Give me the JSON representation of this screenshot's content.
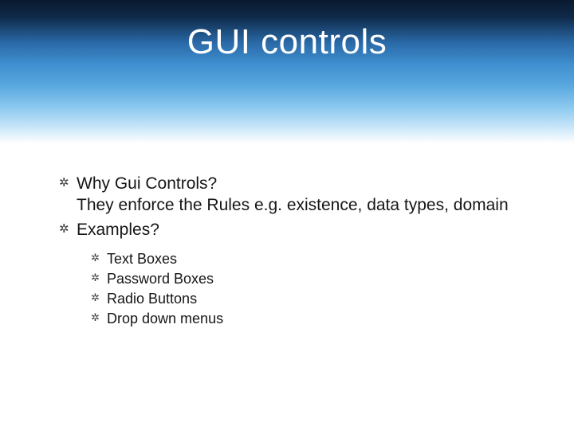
{
  "title": "GUI controls",
  "content": {
    "items": [
      {
        "text": "Why Gui Controls?\nThey enforce the Rules e.g. existence, data types, domain"
      },
      {
        "text": "Examples?",
        "subitems": [
          "Text Boxes",
          "Password Boxes",
          "Radio Buttons",
          "Drop down menus"
        ]
      }
    ]
  }
}
